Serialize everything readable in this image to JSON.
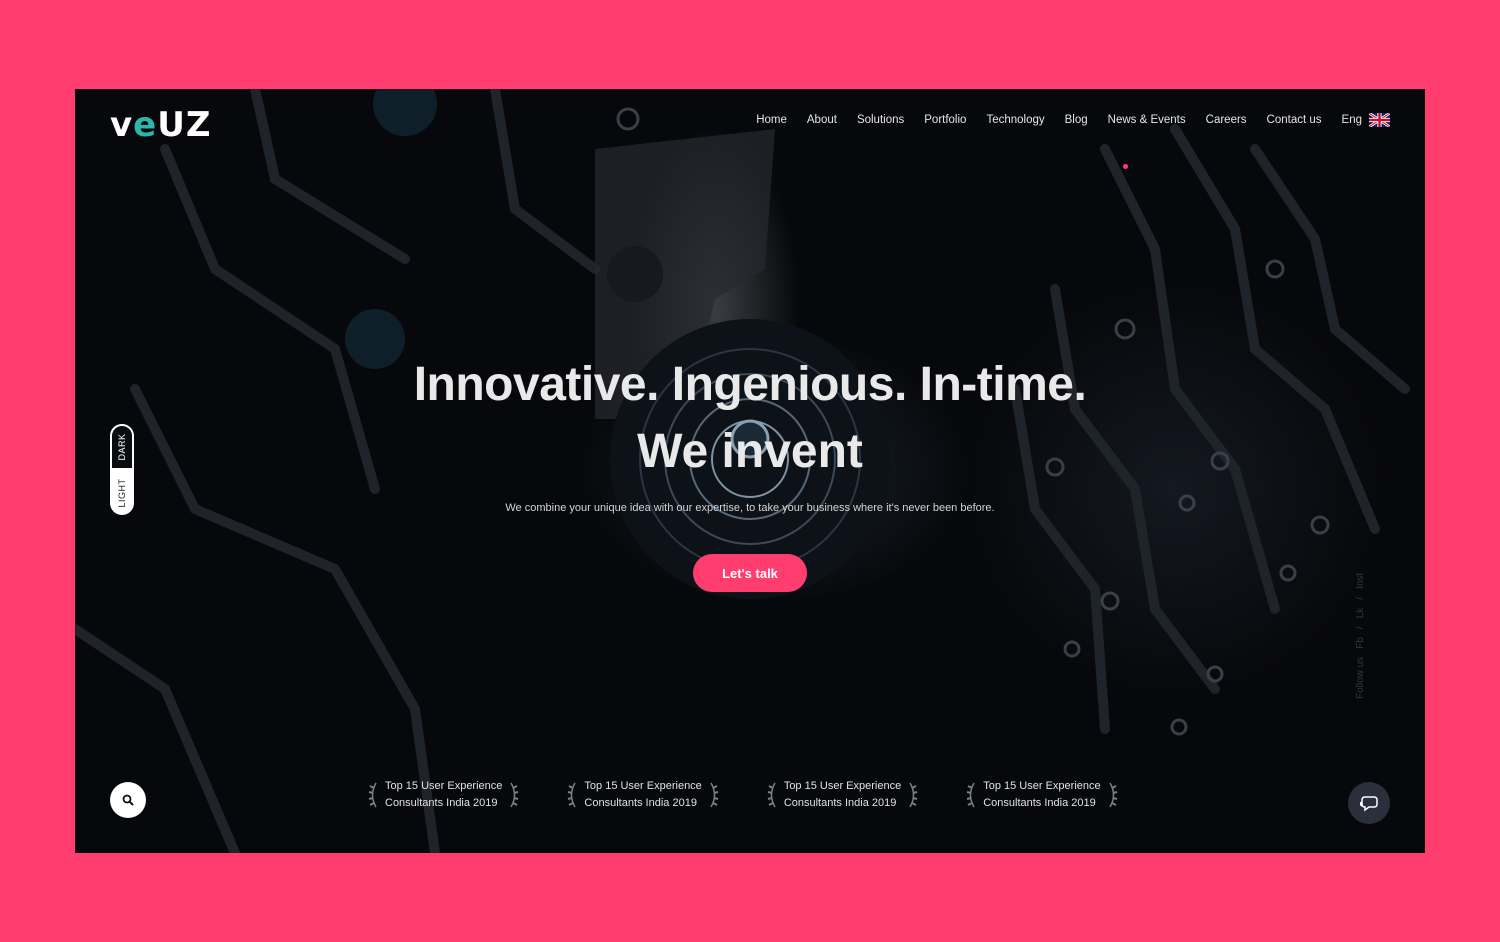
{
  "brand": {
    "logo_text_a": "v",
    "logo_text_e": "e",
    "logo_text_b": "UZ",
    "accent": "#ff3d6e",
    "logo_accent": "#2bb8a8"
  },
  "nav": {
    "items": [
      "Home",
      "About",
      "Solutions",
      "Portfolio",
      "Technology",
      "Blog",
      "News & Events",
      "Careers",
      "Contact us"
    ],
    "language": "Eng",
    "language_icon": "uk-flag-icon"
  },
  "theme_toggle": {
    "dark": "DARK",
    "light": "LIGHT"
  },
  "hero": {
    "headline_1": "Innovative. Ingenious. In-time.",
    "headline_2": "We invent",
    "subtitle": "We combine your unique idea with our expertise, to take your business where it's never been before.",
    "cta": "Let's talk"
  },
  "social": {
    "label": "Follow us",
    "items": [
      "Fb",
      "Lk",
      "Inst"
    ]
  },
  "awards": [
    {
      "line1": "Top 15 User Experience",
      "line2": "Consultants India 2019"
    },
    {
      "line1": "Top 15 User Experience",
      "line2": "Consultants India 2019"
    },
    {
      "line1": "Top 15 User Experience",
      "line2": "Consultants India 2019"
    },
    {
      "line1": "Top 15 User Experience",
      "line2": "Consultants India 2019"
    }
  ],
  "icons": {
    "search": "search-icon",
    "chat": "chat-icon"
  }
}
